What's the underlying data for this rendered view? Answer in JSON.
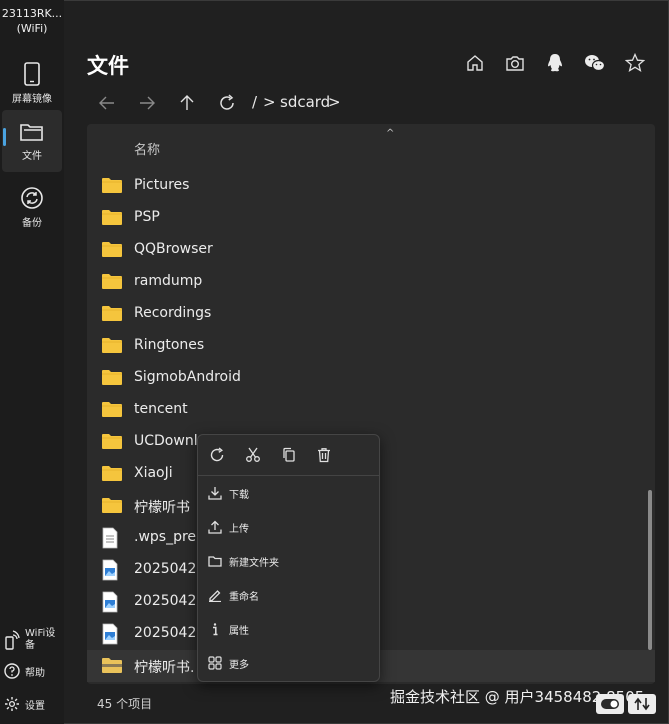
{
  "device": {
    "name": "23113RK...",
    "conn": "(WiFi)"
  },
  "sidebar": {
    "items": [
      {
        "label": "屏幕镜像",
        "icon": "phone-icon"
      },
      {
        "label": "文件",
        "icon": "folder-icon",
        "active": true
      },
      {
        "label": "备份",
        "icon": "sync-icon"
      }
    ],
    "bottom": [
      {
        "label": "WiFi设备",
        "icon": "wifi-device-icon"
      },
      {
        "label": "帮助",
        "icon": "help-icon"
      },
      {
        "label": "设置",
        "icon": "gear-icon"
      }
    ]
  },
  "header": {
    "title": "文件",
    "actions": [
      "home-icon",
      "camera-icon",
      "qq-icon",
      "wechat-icon",
      "star-icon"
    ]
  },
  "navbar": {
    "root": "/",
    "separator": ">",
    "path": "sdcard",
    "trail": ">"
  },
  "list": {
    "column_name": "名称",
    "rows": [
      {
        "name": "Pictures",
        "type": "folder"
      },
      {
        "name": "PSP",
        "type": "folder"
      },
      {
        "name": "QQBrowser",
        "type": "folder"
      },
      {
        "name": "ramdump",
        "type": "folder"
      },
      {
        "name": "Recordings",
        "type": "folder"
      },
      {
        "name": "Ringtones",
        "type": "folder"
      },
      {
        "name": "SigmobAndroid",
        "type": "folder"
      },
      {
        "name": "tencent",
        "type": "folder"
      },
      {
        "name": "UCDownl",
        "type": "folder"
      },
      {
        "name": "XiaoJi",
        "type": "folder"
      },
      {
        "name": "柠檬听书",
        "type": "folder"
      },
      {
        "name": ".wps_prel",
        "type": "file"
      },
      {
        "name": "20250429",
        "type": "image"
      },
      {
        "name": "20250429",
        "type": "image"
      },
      {
        "name": "20250429",
        "type": "image"
      },
      {
        "name": "柠檬听书.",
        "type": "archive",
        "selected": true
      }
    ]
  },
  "status": {
    "count": "45 个项目"
  },
  "watermark": "掘金技术社区 @ 用户3458482 8505",
  "context_menu": {
    "toolbar": [
      "refresh-icon",
      "cut-icon",
      "copy-icon",
      "delete-icon"
    ],
    "items": [
      {
        "label": "下载",
        "icon": "download-icon"
      },
      {
        "label": "上传",
        "icon": "upload-icon"
      },
      {
        "label": "新建文件夹",
        "icon": "new-folder-icon"
      },
      {
        "label": "重命名",
        "icon": "rename-icon"
      },
      {
        "label": "属性",
        "icon": "info-icon"
      },
      {
        "label": "更多",
        "icon": "more-icon"
      }
    ]
  },
  "colors": {
    "accent": "#4aa3e0",
    "folder": "#f5c53d",
    "bg": "#202020",
    "panel": "#2b2b2b"
  }
}
